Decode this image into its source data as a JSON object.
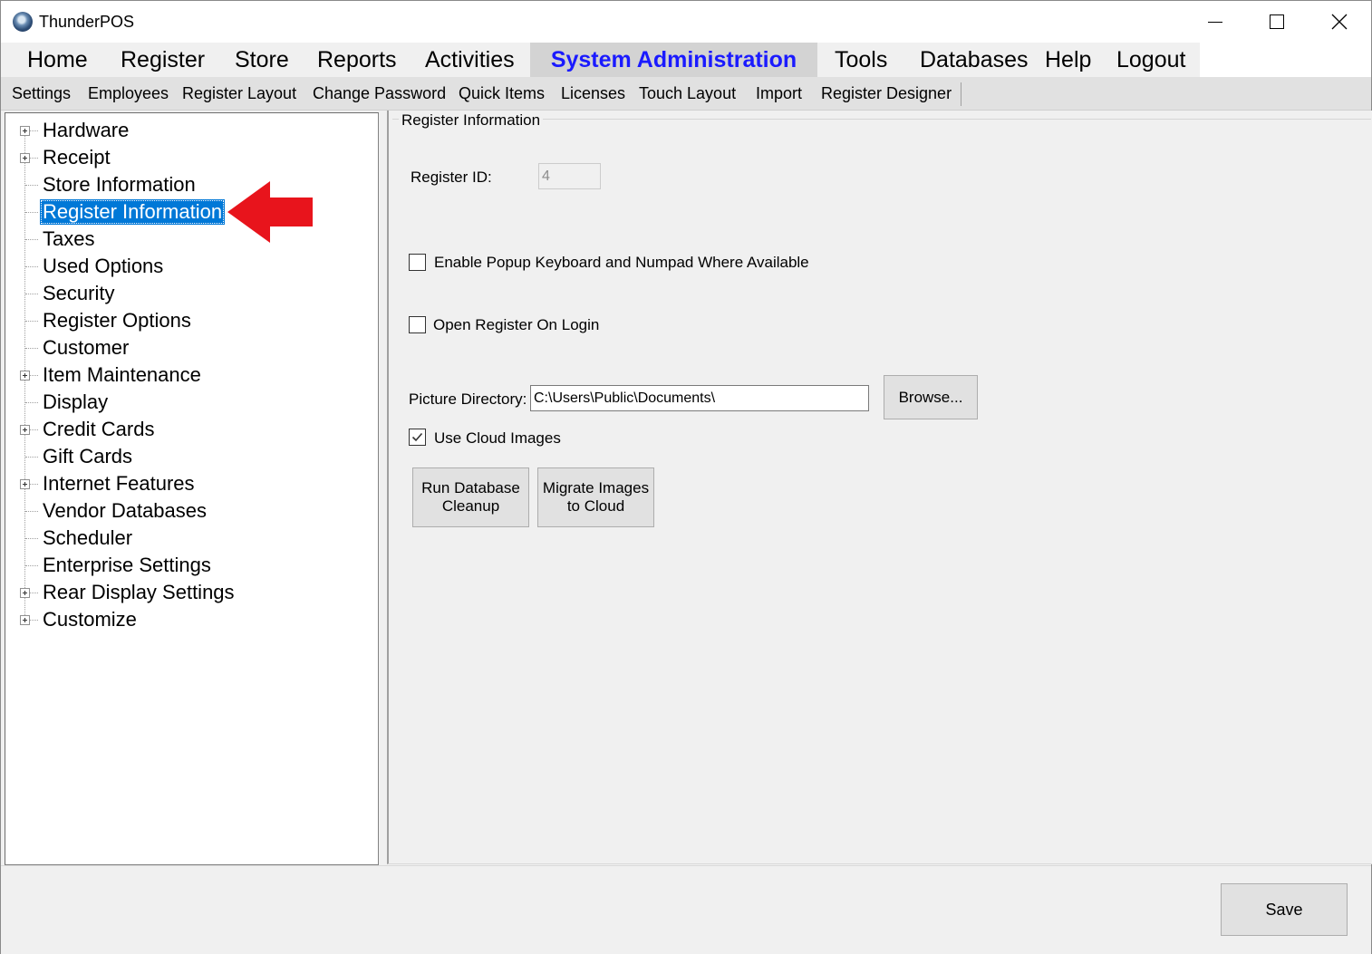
{
  "window": {
    "title": "ThunderPOS"
  },
  "menu": {
    "items": [
      {
        "label": "Home"
      },
      {
        "label": "Register"
      },
      {
        "label": "Store"
      },
      {
        "label": "Reports"
      },
      {
        "label": "Activities"
      },
      {
        "label": "System Administration",
        "active": true
      },
      {
        "label": "Tools"
      },
      {
        "label": "Databases"
      },
      {
        "label": "Help"
      },
      {
        "label": "Logout"
      }
    ]
  },
  "submenu": {
    "items": [
      {
        "label": "Settings"
      },
      {
        "label": "Employees"
      },
      {
        "label": "Register Layout"
      },
      {
        "label": "Change Password"
      },
      {
        "label": "Quick Items"
      },
      {
        "label": "Licenses"
      },
      {
        "label": "Touch Layout"
      },
      {
        "label": "Import"
      },
      {
        "label": "Register Designer"
      }
    ]
  },
  "tree": {
    "items": [
      {
        "label": "Hardware",
        "expandable": true
      },
      {
        "label": "Receipt",
        "expandable": true
      },
      {
        "label": "Store Information",
        "expandable": false
      },
      {
        "label": "Register Information",
        "expandable": false,
        "selected": true
      },
      {
        "label": "Taxes",
        "expandable": false
      },
      {
        "label": "Used Options",
        "expandable": false
      },
      {
        "label": "Security",
        "expandable": false
      },
      {
        "label": "Register Options",
        "expandable": false
      },
      {
        "label": "Customer",
        "expandable": false
      },
      {
        "label": "Item Maintenance",
        "expandable": true
      },
      {
        "label": "Display",
        "expandable": false
      },
      {
        "label": "Credit Cards",
        "expandable": true
      },
      {
        "label": "Gift Cards",
        "expandable": false
      },
      {
        "label": "Internet Features",
        "expandable": true
      },
      {
        "label": "Vendor Databases",
        "expandable": false
      },
      {
        "label": "Scheduler",
        "expandable": false
      },
      {
        "label": "Enterprise Settings",
        "expandable": false
      },
      {
        "label": "Rear Display Settings",
        "expandable": true
      },
      {
        "label": "Customize",
        "expandable": true
      }
    ]
  },
  "register_info": {
    "group_title": "Register Information",
    "register_id_label": "Register ID:",
    "register_id_value": "4",
    "popup_keyboard_label": "Enable Popup Keyboard and Numpad Where Available",
    "popup_keyboard_checked": false,
    "open_register_label": "Open Register On Login",
    "open_register_checked": false,
    "picture_dir_label": "Picture Directory:",
    "picture_dir_value": "C:\\Users\\Public\\Documents\\",
    "browse_label": "Browse...",
    "cloud_images_label": "Use Cloud Images",
    "cloud_images_checked": true,
    "cleanup_line1": "Run Database",
    "cleanup_line2": "Cleanup",
    "migrate_line1": "Migrate Images",
    "migrate_line2": "to Cloud"
  },
  "footer": {
    "save_label": "Save"
  },
  "colors": {
    "selection": "#0078d7",
    "active_menu_text": "#1a1aff",
    "annotation_arrow": "#e8141c"
  }
}
